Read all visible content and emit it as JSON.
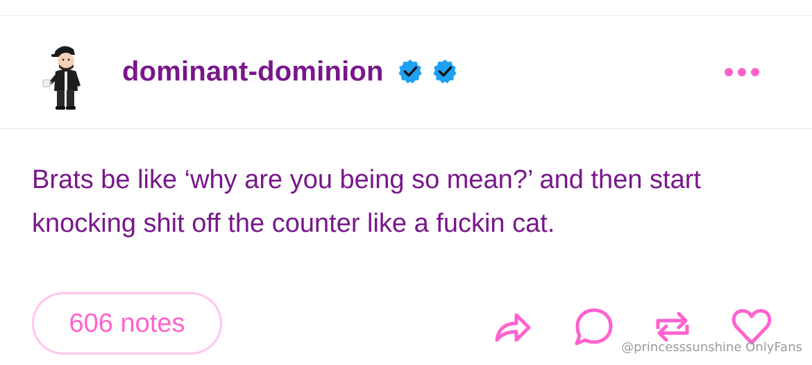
{
  "post": {
    "username": "dominant-dominion",
    "body": "Brats be like ‘why are you being so mean?’ and then start knocking shit off the counter like a fuckin cat.",
    "notes_label": "606 notes"
  },
  "icons": {
    "avatar": "avatar-image",
    "badges": [
      "verified-badge-icon",
      "verified-badge-icon"
    ],
    "more": "more-options-icon",
    "actions": [
      "share-icon",
      "reply-icon",
      "reblog-icon",
      "like-icon"
    ]
  },
  "watermark": "@princesssunshine OnlyFans",
  "colors": {
    "text": "#78178a",
    "accent": "#ff62ce",
    "notes_border": "#ffc6ec",
    "badge": "#1da1f2"
  }
}
